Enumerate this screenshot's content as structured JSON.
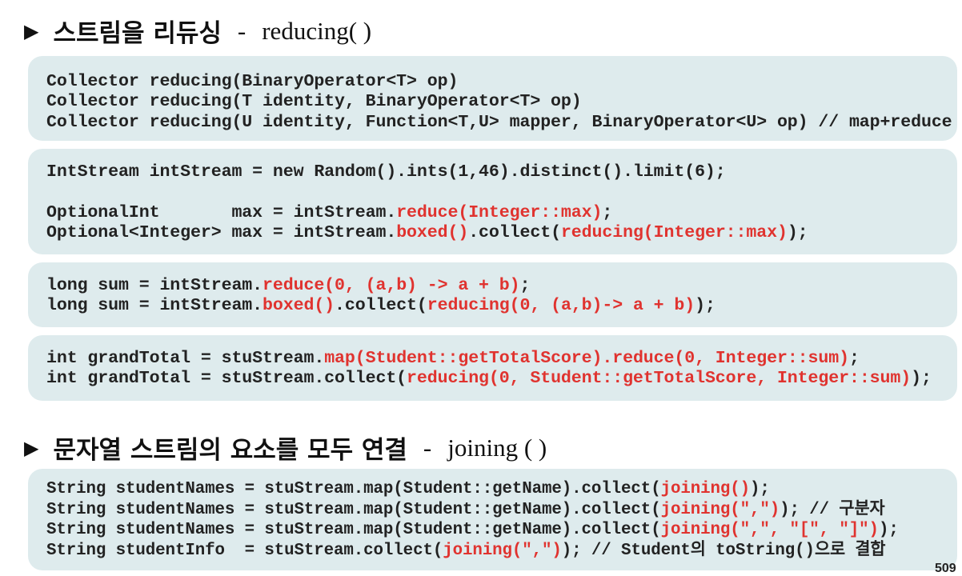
{
  "section1": {
    "title_ko": "스트림을 리듀싱",
    "title_sep": "-",
    "title_fn": "reducing( )",
    "boxes": [
      [
        [
          {
            "t": "Collector reducing(BinaryOperator<T> op)",
            "red": false
          }
        ],
        [
          {
            "t": "Collector reducing(T identity, BinaryOperator<T> op)",
            "red": false
          }
        ],
        [
          {
            "t": "Collector reducing(U identity, Function<T,U> mapper, BinaryOperator<U> op) // map+reduce",
            "red": false
          }
        ]
      ],
      [
        [
          {
            "t": "IntStream intStream = new Random().ints(1,46).distinct().limit(6);",
            "red": false
          }
        ],
        [],
        [
          {
            "t": "OptionalInt       max = intStream.",
            "red": false
          },
          {
            "t": "reduce(Integer::max)",
            "red": true
          },
          {
            "t": ";",
            "red": false
          }
        ],
        [
          {
            "t": "Optional<Integer> max = intStream.",
            "red": false
          },
          {
            "t": "boxed()",
            "red": true
          },
          {
            "t": ".collect(",
            "red": false
          },
          {
            "t": "reducing(Integer::max)",
            "red": true
          },
          {
            "t": ");",
            "red": false
          }
        ]
      ],
      [
        [
          {
            "t": "long sum = intStream.",
            "red": false
          },
          {
            "t": "reduce(0, (a,b) -> a + b)",
            "red": true
          },
          {
            "t": ";",
            "red": false
          }
        ],
        [
          {
            "t": "long sum = intStream.",
            "red": false
          },
          {
            "t": "boxed()",
            "red": true
          },
          {
            "t": ".collect(",
            "red": false
          },
          {
            "t": "reducing(0, (a,b)-> a + b)",
            "red": true
          },
          {
            "t": ");",
            "red": false
          }
        ]
      ],
      [
        [
          {
            "t": "int grandTotal = stuStream.",
            "red": false
          },
          {
            "t": "map(Student::getTotalScore).reduce(0, Integer::sum)",
            "red": true
          },
          {
            "t": ";",
            "red": false
          }
        ],
        [
          {
            "t": "int grandTotal = stuStream.collect(",
            "red": false
          },
          {
            "t": "reducing(0, Student::getTotalScore, Integer::sum)",
            "red": true
          },
          {
            "t": ");",
            "red": false
          }
        ]
      ]
    ]
  },
  "section2": {
    "title_ko": "문자열 스트림의 요소를 모두 연결",
    "title_sep": "-",
    "title_fn": "joining ( )",
    "boxes": [
      [
        [
          {
            "t": "String studentNames = stuStream.map(Student::getName).collect(",
            "red": false
          },
          {
            "t": "joining()",
            "red": true
          },
          {
            "t": ");",
            "red": false
          }
        ],
        [
          {
            "t": "String studentNames = stuStream.map(Student::getName).collect(",
            "red": false
          },
          {
            "t": "joining(\",\")",
            "red": true
          },
          {
            "t": "); // 구분자",
            "red": false
          }
        ],
        [
          {
            "t": "String studentNames = stuStream.map(Student::getName).collect(",
            "red": false
          },
          {
            "t": "joining(\",\", \"[\", \"]\")",
            "red": true
          },
          {
            "t": ");",
            "red": false
          }
        ],
        [
          {
            "t": "String studentInfo  = stuStream.collect(",
            "red": false
          },
          {
            "t": "joining(\",\")",
            "red": true
          },
          {
            "t": "); // Student의 toString()으로 결합",
            "red": false
          }
        ]
      ]
    ]
  },
  "page_number": "509"
}
